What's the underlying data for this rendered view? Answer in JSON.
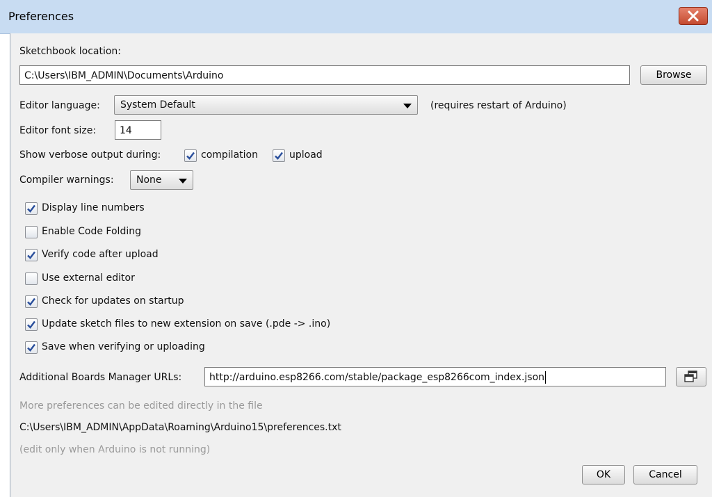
{
  "window": {
    "title": "Preferences",
    "close_label": "✕"
  },
  "sketchbook": {
    "label": "Sketchbook location:",
    "value": "C:\\Users\\IBM_ADMIN\\Documents\\Arduino",
    "browse_label": "Browse"
  },
  "editor_language": {
    "label": "Editor language:",
    "value": "System Default",
    "note": "(requires restart of Arduino)"
  },
  "font_size": {
    "label": "Editor font size:",
    "value": "14"
  },
  "verbose": {
    "label": "Show verbose output during:",
    "compilation_label": "compilation",
    "compilation_checked": true,
    "upload_label": "upload",
    "upload_checked": true
  },
  "compiler_warnings": {
    "label": "Compiler warnings:",
    "value": "None"
  },
  "options": [
    {
      "label": "Display line numbers",
      "checked": true
    },
    {
      "label": "Enable Code Folding",
      "checked": false
    },
    {
      "label": "Verify code after upload",
      "checked": true
    },
    {
      "label": "Use external editor",
      "checked": false
    },
    {
      "label": "Check for updates on startup",
      "checked": true
    },
    {
      "label": "Update sketch files to new extension on save (.pde -> .ino)",
      "checked": true
    },
    {
      "label": "Save when verifying or uploading",
      "checked": true
    }
  ],
  "boards_manager": {
    "label": "Additional Boards Manager URLs:",
    "value": "http://arduino.esp8266.com/stable/package_esp8266com_index.json"
  },
  "footer": {
    "more_text": "More preferences can be edited directly in the file",
    "path": "C:\\Users\\IBM_ADMIN\\AppData\\Roaming\\Arduino15\\preferences.txt",
    "edit_note": "(edit only when Arduino is not running)"
  },
  "buttons": {
    "ok_label": "OK",
    "cancel_label": "Cancel"
  },
  "colors": {
    "titlebar": "#c8dcf2",
    "dialog_bg": "#f0f0f0",
    "close_button": "#c44a2f",
    "check_blue": "#2a4f9c",
    "muted_text": "#9a9a9a"
  }
}
